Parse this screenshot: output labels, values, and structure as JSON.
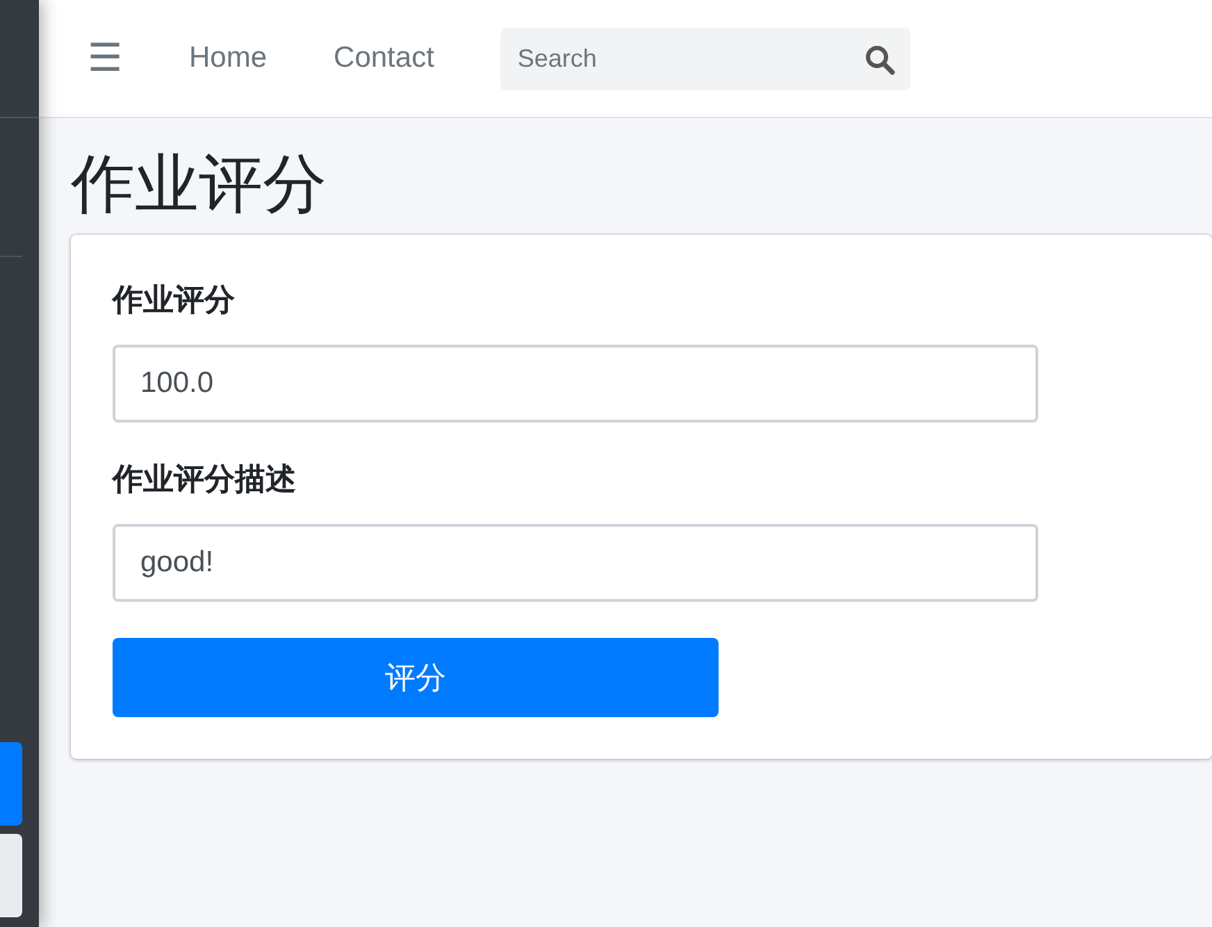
{
  "sidebar": {
    "items": [
      {
        "selected": true
      },
      {
        "selected": false
      }
    ]
  },
  "navbar": {
    "menu_icon": "☰",
    "links": [
      "Home",
      "Contact"
    ],
    "search": {
      "placeholder": "Search"
    }
  },
  "page_title": "作业评分",
  "form": {
    "fields": [
      {
        "label": "作业评分",
        "value": "100.0"
      },
      {
        "label": "作业评分描述",
        "value": "good!"
      }
    ],
    "submit_button": "评分"
  }
}
